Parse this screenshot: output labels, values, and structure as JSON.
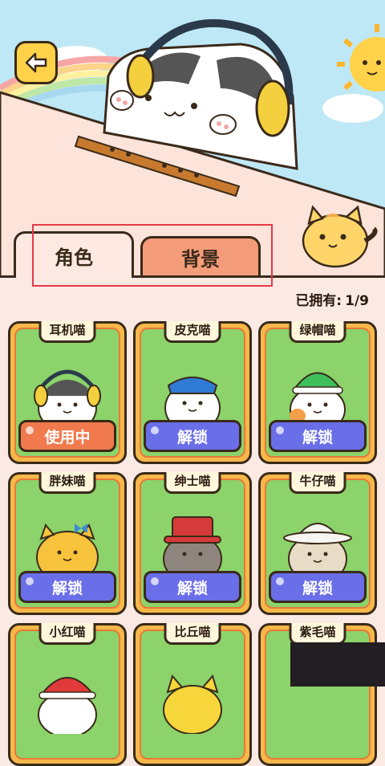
{
  "back_button": {
    "icon": "back-arrow-icon"
  },
  "tabs": [
    {
      "label": "角色",
      "active": true
    },
    {
      "label": "背景",
      "active": false
    }
  ],
  "owned": {
    "label": "已拥有:",
    "value": "1/9"
  },
  "cards": [
    {
      "name": "耳机喵",
      "button": "使用中",
      "state": "in-use"
    },
    {
      "name": "皮克喵",
      "button": "解锁",
      "state": "locked"
    },
    {
      "name": "绿帽喵",
      "button": "解锁",
      "state": "locked"
    },
    {
      "name": "胖妹喵",
      "button": "解锁",
      "state": "locked"
    },
    {
      "name": "绅士喵",
      "button": "解锁",
      "state": "locked"
    },
    {
      "name": "牛仔喵",
      "button": "解锁",
      "state": "locked"
    },
    {
      "name": "小红喵",
      "button": "",
      "state": "locked"
    },
    {
      "name": "比丘喵",
      "button": "",
      "state": "locked"
    },
    {
      "name": "紫毛喵",
      "button": "",
      "state": "locked"
    }
  ],
  "colors": {
    "unlock": "#6a6ee8",
    "in_use": "#f07a4e",
    "card_green": "#8bd36a",
    "card_frame": "#f7b84a"
  }
}
